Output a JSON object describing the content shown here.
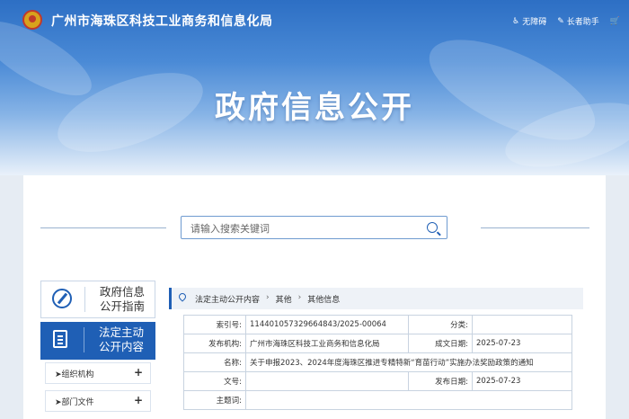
{
  "header": {
    "site_title": "广州市海珠区科技工业商务和信息化局",
    "tools": [
      {
        "icon": "accessibility-icon",
        "label": "无障碍"
      },
      {
        "icon": "elder-icon",
        "label": "长者助手"
      },
      {
        "icon": "cart-icon",
        "label": ""
      }
    ]
  },
  "hero": {
    "title": "政府信息公开"
  },
  "search": {
    "placeholder": "请输入搜索关键词"
  },
  "sidebar": {
    "guide": {
      "line1": "政府信息",
      "line2": "公开指南"
    },
    "active": {
      "line1": "法定主动",
      "line2": "公开内容"
    },
    "items": [
      {
        "label": "组织机构"
      },
      {
        "label": "部门文件"
      }
    ]
  },
  "breadcrumb": [
    "法定主动公开内容",
    "其他",
    "其他信息"
  ],
  "info": {
    "index_label": "索引号:",
    "index_value": "114401057329664843/2025-00064",
    "category_label": "分类:",
    "category_value": "",
    "publisher_label": "发布机构:",
    "publisher_value": "广州市海珠区科技工业商务和信息化局",
    "created_label": "成文日期:",
    "created_value": "2025-07-23",
    "name_label": "名称:",
    "name_value": "关于申报2023、2024年度海珠区推进专精特新“育苗行动”实施办法奖励政策的通知",
    "docno_label": "文号:",
    "docno_value": "",
    "published_label": "发布日期:",
    "published_value": "2025-07-23",
    "subject_label": "主题词:",
    "subject_value": ""
  },
  "colors": {
    "primary": "#1f5fb5",
    "hero_top": "#2d6fc4",
    "background": "#e6ecf3"
  }
}
